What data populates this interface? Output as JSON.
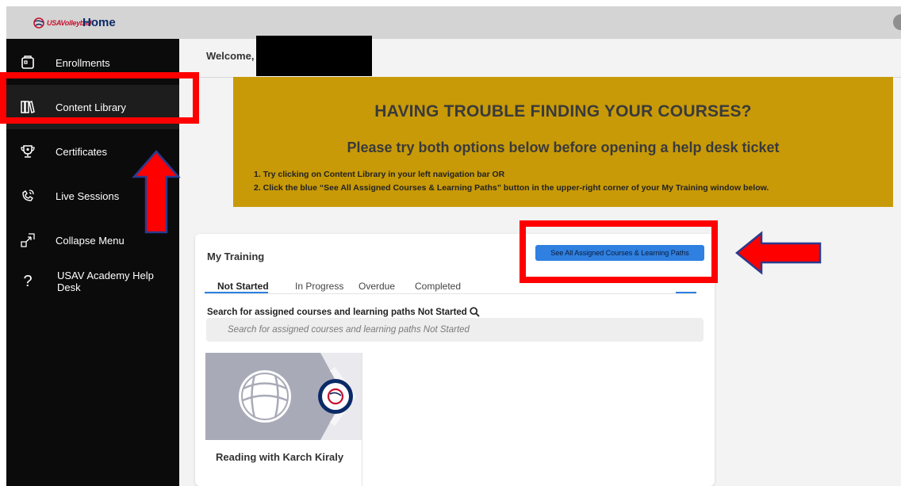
{
  "header": {
    "logo_text": "USAVolleyball",
    "title": "Home"
  },
  "sidebar": {
    "items": [
      {
        "label": "Enrollments",
        "icon": "enrollments-icon"
      },
      {
        "label": "Content Library",
        "icon": "library-icon"
      },
      {
        "label": "Certificates",
        "icon": "certificate-icon"
      },
      {
        "label": "Live Sessions",
        "icon": "live-session-icon"
      },
      {
        "label": "Collapse Menu",
        "icon": "collapse-icon"
      },
      {
        "label": "USAV Academy Help Desk",
        "icon": "help-icon"
      }
    ]
  },
  "welcome": {
    "text": "Welcome,"
  },
  "banner": {
    "heading": "HAVING TROUBLE FINDING YOUR COURSES?",
    "subheading": "Please try both options below before opening a help desk ticket",
    "steps": [
      "1. Try clicking on Content Library in your left navigation bar OR",
      "2. Click the blue “See All Assigned Courses & Learning Paths” button in the upper-right corner of your My Training window below."
    ]
  },
  "training": {
    "title": "My Training",
    "see_all_label": "See All Assigned Courses & Learning Paths",
    "tabs": [
      "Not Started",
      "In Progress",
      "Overdue",
      "Completed"
    ],
    "search_label": "Search for assigned courses and learning paths Not Started",
    "search_placeholder": "Search for assigned courses and learning paths Not Started",
    "courses": [
      {
        "title": "Reading with Karch Kiraly",
        "badge_text": "USAVolleyball"
      }
    ]
  },
  "colors": {
    "banner_bg": "#c89a07",
    "sidebar_bg": "#0b0b0b",
    "accent_blue": "#2f80e0",
    "annotation_red": "#ff0000"
  }
}
